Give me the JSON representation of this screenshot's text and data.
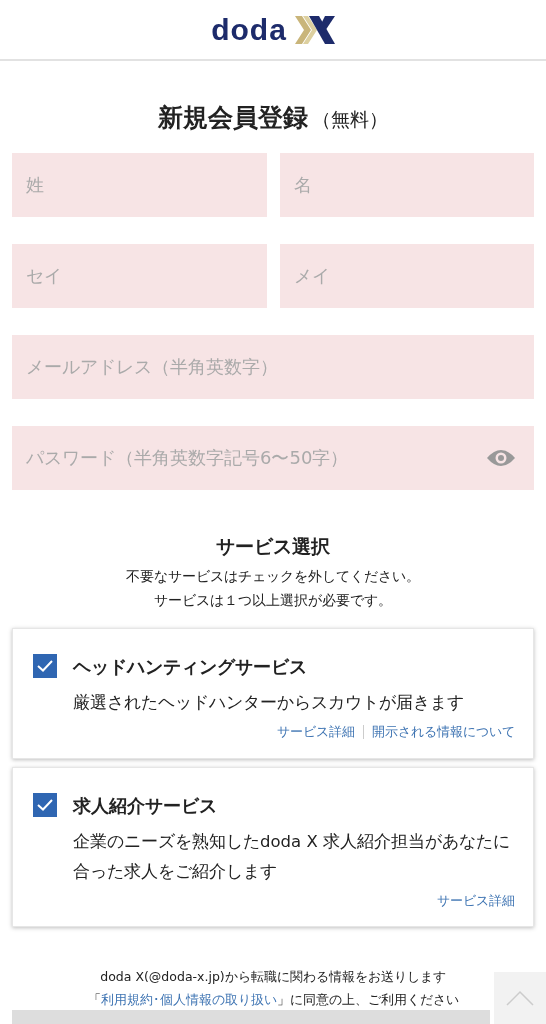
{
  "header": {
    "logo_text": "doda"
  },
  "title": {
    "main": "新規会員登録",
    "sub": "（無料）"
  },
  "fields": [
    {
      "placeholder": "姓",
      "kind": "half"
    },
    {
      "placeholder": "名",
      "kind": "half"
    },
    {
      "placeholder": "セイ",
      "kind": "half"
    },
    {
      "placeholder": "メイ",
      "kind": "half"
    },
    {
      "placeholder": "メールアドレス（半角英数字）",
      "kind": "full"
    },
    {
      "placeholder": "パスワード（半角英数字記号6〜50字）",
      "kind": "password"
    }
  ],
  "service_section": {
    "heading": "サービス選択",
    "notes": [
      "不要なサービスはチェックを外してください。",
      "サービスは１つ以上選択が必要です。"
    ]
  },
  "services": [
    {
      "name": "ヘッドハンティングサービス",
      "checked": true,
      "description": "厳選されたヘッドハンターからスカウトが届きます",
      "links": [
        "サービス詳細",
        "開示される情報について"
      ]
    },
    {
      "name": "求人紹介サービス",
      "checked": true,
      "description": "企業のニーズを熟知したdoda X 求人紹介担当があなたに合った求人をご紹介します",
      "links": [
        "サービス詳細"
      ]
    }
  ],
  "footer": {
    "notice": "doda X(@doda-x.jp)から転職に関わる情報をお送りします",
    "consent_prefix": "「",
    "consent_link": "利用規約･個人情報の取り扱い",
    "consent_suffix": "」に同意の上、ご利用ください"
  }
}
